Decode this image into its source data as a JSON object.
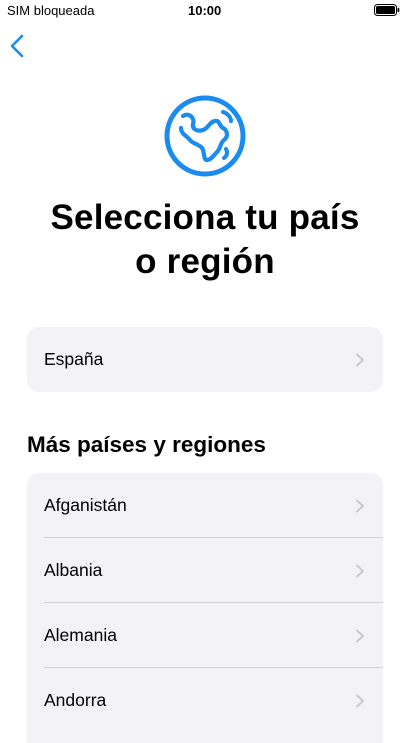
{
  "status_bar": {
    "carrier": "SIM bloqueada",
    "time": "10:00"
  },
  "nav": {
    "back_icon": "chevron-left-icon"
  },
  "header": {
    "icon": "globe-icon",
    "title_line1": "Selecciona tu país",
    "title_line2": "o región"
  },
  "suggested": {
    "label": "España"
  },
  "more": {
    "heading": "Más países y regiones",
    "items": [
      {
        "label": "Afganistán"
      },
      {
        "label": "Albania"
      },
      {
        "label": "Alemania"
      },
      {
        "label": "Andorra"
      }
    ]
  },
  "colors": {
    "accent": "#1a8cf0",
    "cell_background": "#f2f2f7",
    "chevron": "#c4c4c7"
  }
}
